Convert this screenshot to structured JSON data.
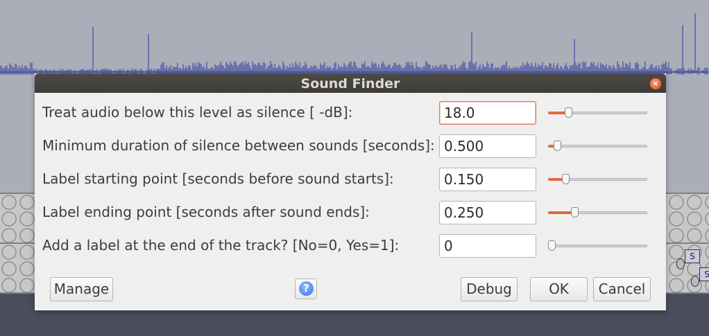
{
  "background": {
    "track_label_s1": "S",
    "track_label_s2": "S"
  },
  "dialog": {
    "title": "Sound Finder",
    "close_icon": "close-icon",
    "rows": [
      {
        "label": "Treat audio below this level as silence [ -dB]:",
        "value": "18.0",
        "slider_fraction": 0.18
      },
      {
        "label": "Minimum duration of silence between sounds [seconds]:",
        "value": "0.500",
        "slider_fraction": 0.06
      },
      {
        "label": "Label starting point [seconds before sound starts]:",
        "value": "0.150",
        "slider_fraction": 0.15
      },
      {
        "label": "Label ending point [seconds after sound ends]:",
        "value": "0.250",
        "slider_fraction": 0.25
      },
      {
        "label": "Add a label at the end of the track? [No=0, Yes=1]:",
        "value": "0",
        "slider_fraction": 0.0
      }
    ],
    "buttons": {
      "manage": "Manage",
      "help": "?",
      "debug": "Debug",
      "ok": "OK",
      "cancel": "Cancel"
    },
    "colors": {
      "accent": "#e06a3e",
      "titlebar": "#3c3b37",
      "help": "#3a78e6"
    }
  }
}
